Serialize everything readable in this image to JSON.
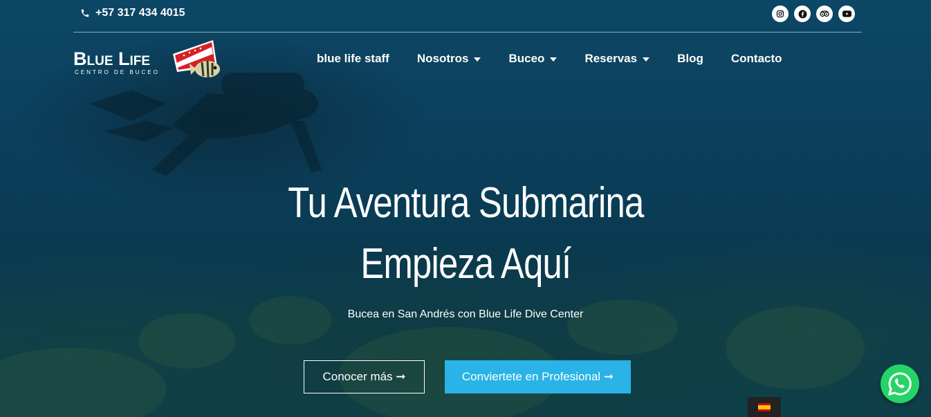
{
  "topbar": {
    "phone": "+57 317 434 4015",
    "phone_icon": "phone-icon",
    "socials": [
      "instagram-icon",
      "facebook-icon",
      "tripadvisor-icon",
      "youtube-icon"
    ]
  },
  "logo": {
    "name": "Blue Life",
    "tagline": "CENTRO DE BUCEO"
  },
  "nav": {
    "items": [
      {
        "label": "blue life staff",
        "dropdown": false
      },
      {
        "label": "Nosotros",
        "dropdown": true
      },
      {
        "label": "Buceo",
        "dropdown": true
      },
      {
        "label": "Reservas",
        "dropdown": true
      },
      {
        "label": "Blog",
        "dropdown": false
      },
      {
        "label": "Contacto",
        "dropdown": false
      }
    ]
  },
  "hero": {
    "title_line1": "Tu Aventura Submarina",
    "title_line2": "Empieza Aquí",
    "subtitle": "Bucea en San Andrés con Blue Life Dive Center",
    "btn_primary": "Conocer más ➞",
    "btn_secondary": "Conviertete en Profesional ➞"
  },
  "colors": {
    "accent": "#29b3e6",
    "whatsapp": "#25d366"
  },
  "widgets": {
    "whatsapp_icon": "whatsapp-icon",
    "language_flag": "spain-flag-icon"
  }
}
